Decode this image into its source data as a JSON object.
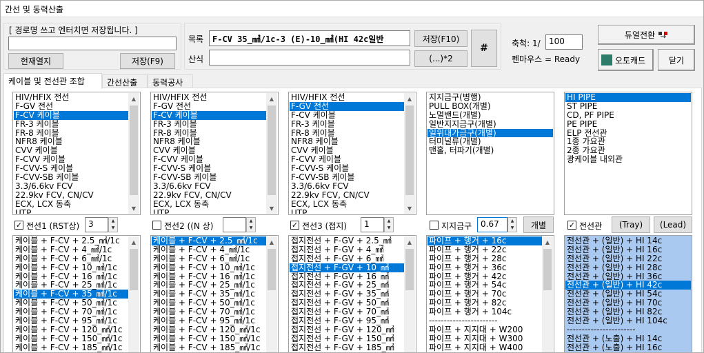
{
  "window": {
    "title": "간선 및 동력산출"
  },
  "route": {
    "group_label": "[ 경로명 쓰고 엔터치면 저장됩니다. ]",
    "name_value": "",
    "current_button": "현재열지",
    "save_button": "저장(F9)"
  },
  "formula": {
    "label_list": "목록",
    "list_value": "F-CV 35_㎟/1c-3 (E)-10_㎟(HI 42c일반",
    "label_calc": "산식",
    "calc_value": "",
    "save_button": "저장(F10)",
    "paren_button": "(...)*2",
    "hash_button": "#"
  },
  "scale": {
    "label": "축척: 1/",
    "value": "100",
    "pen_status": "펜마우스 = Ready"
  },
  "buttons": {
    "dual_switch": "듀얼전환",
    "autocad": "오토캐드",
    "close": "닫기"
  },
  "tabs": [
    {
      "label": "케이블 및 전선관 조합",
      "active": true
    },
    {
      "label": "간선산출",
      "active": false
    },
    {
      "label": "동력공사",
      "active": false
    }
  ],
  "cable_types": [
    "HIV/HFIX 전선",
    "F-GV  전선",
    "F-CV  케이블",
    "FR-3  케이블",
    "FR-8  케이블",
    "NFR8  케이블",
    "CVV   케이블",
    "F-CVV 케이블",
    "F-CVV-S 케이블",
    "F-CVV-SB 케이블",
    "3.3/6.6kv FCV",
    "22.9kv FCV, CN/CV",
    "ECX, LCX 동축",
    "UTP"
  ],
  "list1": {
    "selected": 2
  },
  "list2": {
    "selected": 2
  },
  "list3": {
    "selected": 1
  },
  "ground_types": {
    "items": [
      "지지금구(병행)",
      "PULL BOX(개별)",
      "노멀밴드(개별)",
      "일반지지금구(개별)",
      "일위대가금구(개별)",
      "터미널류(개별)",
      "맨홀, 터파기(개별)"
    ],
    "selected": 4
  },
  "conduit_types": {
    "items": [
      "HI PIPE",
      "ST PIPE",
      "CD, PF PIPE",
      "PE PIPE",
      "ELP 전선관",
      "1종 가요관",
      "2종 가요관",
      "광케이블 내외관"
    ],
    "selected": 0
  },
  "options": {
    "wire1": {
      "label": "전선1 (RST상)",
      "checked": true,
      "value": "3"
    },
    "wire2": {
      "label": "전선2 ((N 상)",
      "checked": false,
      "value": ""
    },
    "wire3": {
      "label": "전선3 (접지)",
      "checked": true,
      "value": "1"
    },
    "support": {
      "label": "지지금구",
      "checked": false,
      "value": "0.67",
      "button": "개별"
    },
    "conduit": {
      "label": "전선관",
      "checked": true,
      "tray": "(Tray)",
      "lead": "(Lead)"
    }
  },
  "list_a": {
    "items": [
      "케이블 + F-CV + 2.5_㎟/1c",
      "케이블 + F-CV + 4_㎟/1c",
      "케이블 + F-CV + 6_㎟/1c",
      "케이블 + F-CV + 10_㎟/1c",
      "케이블 + F-CV + 16_㎟/1c",
      "케이블 + F-CV + 25_㎟/1c",
      "케이블 + F-CV + 35_㎟/1c",
      "케이블 + F-CV + 50_㎟/1c",
      "케이블 + F-CV + 70_㎟/1c",
      "케이블 + F-CV + 95_㎟/1c",
      "케이블 + F-CV + 120_㎟/1c",
      "케이블 + F-CV + 150_㎟/1c",
      "케이블 + F-CV + 185_㎟/1c"
    ],
    "selected": 6
  },
  "list_b": {
    "items": [
      "케이블 + F-CV + 2.5_㎟/1c",
      "케이블 + F-CV + 4_㎟/1c",
      "케이블 + F-CV + 6_㎟/1c",
      "케이블 + F-CV + 10_㎟/1c",
      "케이블 + F-CV + 16_㎟/1c",
      "케이블 + F-CV + 25_㎟/1c",
      "케이블 + F-CV + 35_㎟/1c",
      "케이블 + F-CV + 50_㎟/1c",
      "케이블 + F-CV + 70_㎟/1c",
      "케이블 + F-CV + 95_㎟/1c",
      "케이블 + F-CV + 120_㎟/1c",
      "케이블 + F-CV + 150_㎟/1c",
      "케이블 + F-CV + 185_㎟/1c"
    ],
    "selected": 0
  },
  "list_c": {
    "items": [
      "접지전선 + F-GV + 2.5_㎟",
      "접지전선 + F-GV + 4_㎟",
      "접지전선 + F-GV + 6_㎟",
      "접지전선 + F-GV + 10_㎟",
      "접지전선 + F-GV + 16_㎟",
      "접지전선 + F-GV + 25_㎟",
      "접지전선 + F-GV + 35_㎟",
      "접지전선 + F-GV + 50_㎟",
      "접지전선 + F-GV + 70_㎟",
      "접지전선 + F-GV + 95_㎟",
      "접지전선 + F-GV + 120_㎟",
      "접지전선 + F-GV + 150_㎟",
      "접지전선 + F-GV + 185_㎟"
    ],
    "selected": 3
  },
  "list_d": {
    "items": [
      "파이프 + 행거 + 16c",
      "파이프 + 행거 + 22c",
      "파이프 + 행거 + 28c",
      "파이프 + 행거 + 36c",
      "파이프 + 행거 + 42c",
      "파이프 + 행거 + 54c",
      "파이프 + 행거 + 70c",
      "파이프 + 행거 + 82c",
      "파이프 + 행거 + 104c",
      "-----------------------",
      "파이프 + 지지대 + W200",
      "파이프 + 지지대 + W300",
      "파이프 + 지지대 + W400"
    ],
    "selected": 0
  },
  "list_e": {
    "items": [
      "전선관 + (일반) + HI 14c",
      "전선관 + (일반) + HI 16c",
      "전선관 + (일반) + HI 22c",
      "전선관 + (일반) + HI 28c",
      "전선관 + (일반) + HI 36c",
      "전선관 + (일반) + HI 42c",
      "전선관 + (일반) + HI 54c",
      "전선관 + (일반) + HI 70c",
      "전선관 + (일반) + HI 82c",
      "전선관 + (일반) + HI 104c",
      "-----------------------",
      "전선관 + (노출) + HI 14c",
      "전선관 + (노출) + HI 16c"
    ],
    "selected": 5
  },
  "colors": {
    "selection": "#0078d7",
    "blue_list": "#a9c9f0"
  }
}
